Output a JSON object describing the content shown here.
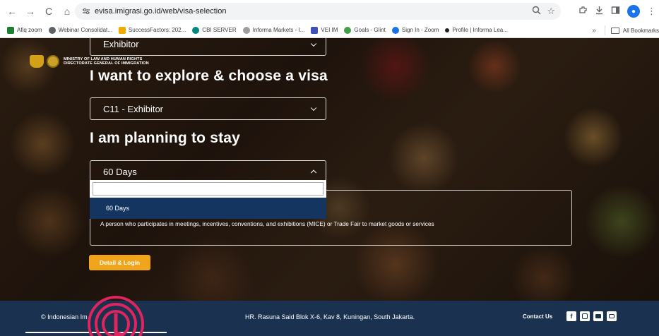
{
  "browser": {
    "url": "evisa.imigrasi.go.id/web/visa-selection",
    "nav": {
      "back": "←",
      "forward": "→",
      "reload": "C",
      "home": "⌂"
    },
    "omni_icons": [
      "zoom-icon",
      "star-icon"
    ],
    "bookmarks": [
      {
        "label": "Afiq zoom",
        "color": "#1e7e34"
      },
      {
        "label": "Webinar Consolidat...",
        "color": "#5f6368"
      },
      {
        "label": "SuccessFactors: 202...",
        "color": "#f0ab00"
      },
      {
        "label": "CBI SERVER",
        "color": "#00897b"
      },
      {
        "label": "Informa Markets - I...",
        "color": "#9e9e9e"
      },
      {
        "label": "VEI IM",
        "color": "#3f51b5"
      },
      {
        "label": "Goals - Glint",
        "color": "#43a047"
      },
      {
        "label": "Sign In - Zoom",
        "color": "#1a73e8"
      },
      {
        "label": "Profile | Informa Lea...",
        "color": "#202124"
      }
    ],
    "bookmarks_overflow": "»",
    "all_bookmarks": "All Bookmarks"
  },
  "site": {
    "logo_line1": "MINISTRY OF LAW AND HUMAN RIGHTS",
    "logo_line2": "DIRECTORATE GENERAL OF IMMIGRATION"
  },
  "form": {
    "top_select_value": "Exhibitor",
    "visa_heading": "I want to explore & choose a visa",
    "visa_select_value": "C11 - Exhibitor",
    "stay_heading": "I am planning to stay",
    "stay_select_value": "60 Days",
    "dropdown_options": [
      "60 Days"
    ],
    "description": "A person who participates in meetings, incentives, conventions, and exhibitions (MICE) or Trade Fair to market goods or services",
    "cta_label": "Detail & Login"
  },
  "footer": {
    "copyright": "© Indonesian Im",
    "address": "HR. Rasuna Said Blok X-6, Kav 8, Kuningan, South Jakarta.",
    "contact": "Contact Us"
  },
  "colors": {
    "accent": "#f0a51b",
    "footer_bg": "#1a3150",
    "dropdown_selected": "#14355f",
    "chat_widget": "#e0245e"
  }
}
